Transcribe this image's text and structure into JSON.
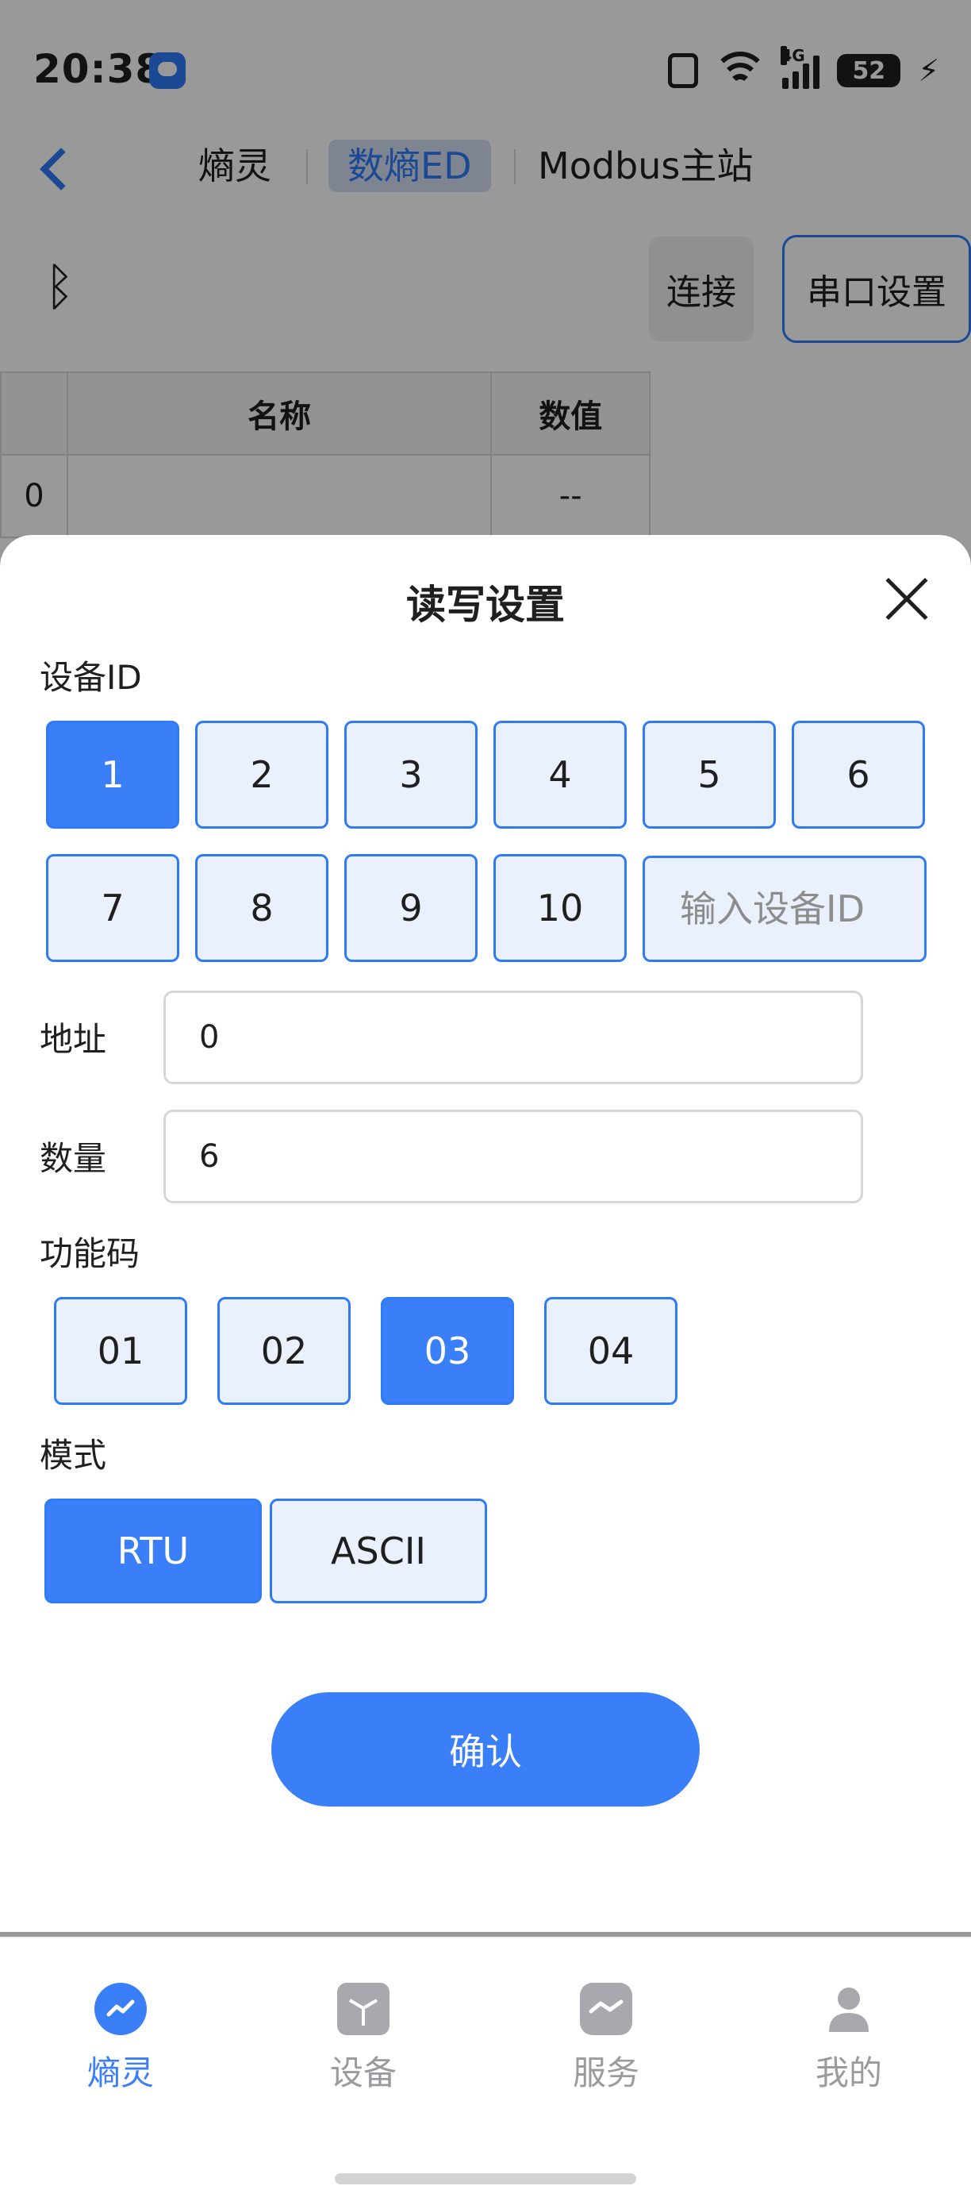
{
  "status_bar": {
    "time": "20:38",
    "battery": "52"
  },
  "nav": {
    "tabs": [
      "熵灵",
      "数熵ED",
      "Modbus主站"
    ]
  },
  "toolbar": {
    "connect_label": "连接",
    "serial_label": "串口设置"
  },
  "table": {
    "headers": [
      "",
      "名称",
      "数值"
    ],
    "rows": [
      {
        "index": "0",
        "name": "",
        "value": "--"
      }
    ]
  },
  "dialog": {
    "title": "读写设置",
    "device_id": {
      "label": "设备ID",
      "options": [
        "1",
        "2",
        "3",
        "4",
        "5",
        "6",
        "7",
        "8",
        "9",
        "10"
      ],
      "selected": "1",
      "custom_placeholder": "输入设备ID"
    },
    "address": {
      "label": "地址",
      "value": "0"
    },
    "quantity": {
      "label": "数量",
      "value": "6"
    },
    "function_code": {
      "label": "功能码",
      "options": [
        "01",
        "02",
        "03",
        "04"
      ],
      "selected": "03"
    },
    "mode": {
      "label": "模式",
      "options": [
        "RTU",
        "ASCII"
      ],
      "selected": "RTU"
    },
    "confirm_label": "确认"
  },
  "tabbar": {
    "items": [
      {
        "label": "熵灵",
        "icon": "trend-icon",
        "active": true
      },
      {
        "label": "设备",
        "icon": "cube-icon",
        "active": false
      },
      {
        "label": "服务",
        "icon": "handshake-icon",
        "active": false
      },
      {
        "label": "我的",
        "icon": "person-icon",
        "active": false
      }
    ]
  },
  "colors": {
    "accent": "#3a7ef8",
    "chip_bg": "#ebf1fc",
    "overlay": "rgba(0,0,0,0.4)"
  }
}
